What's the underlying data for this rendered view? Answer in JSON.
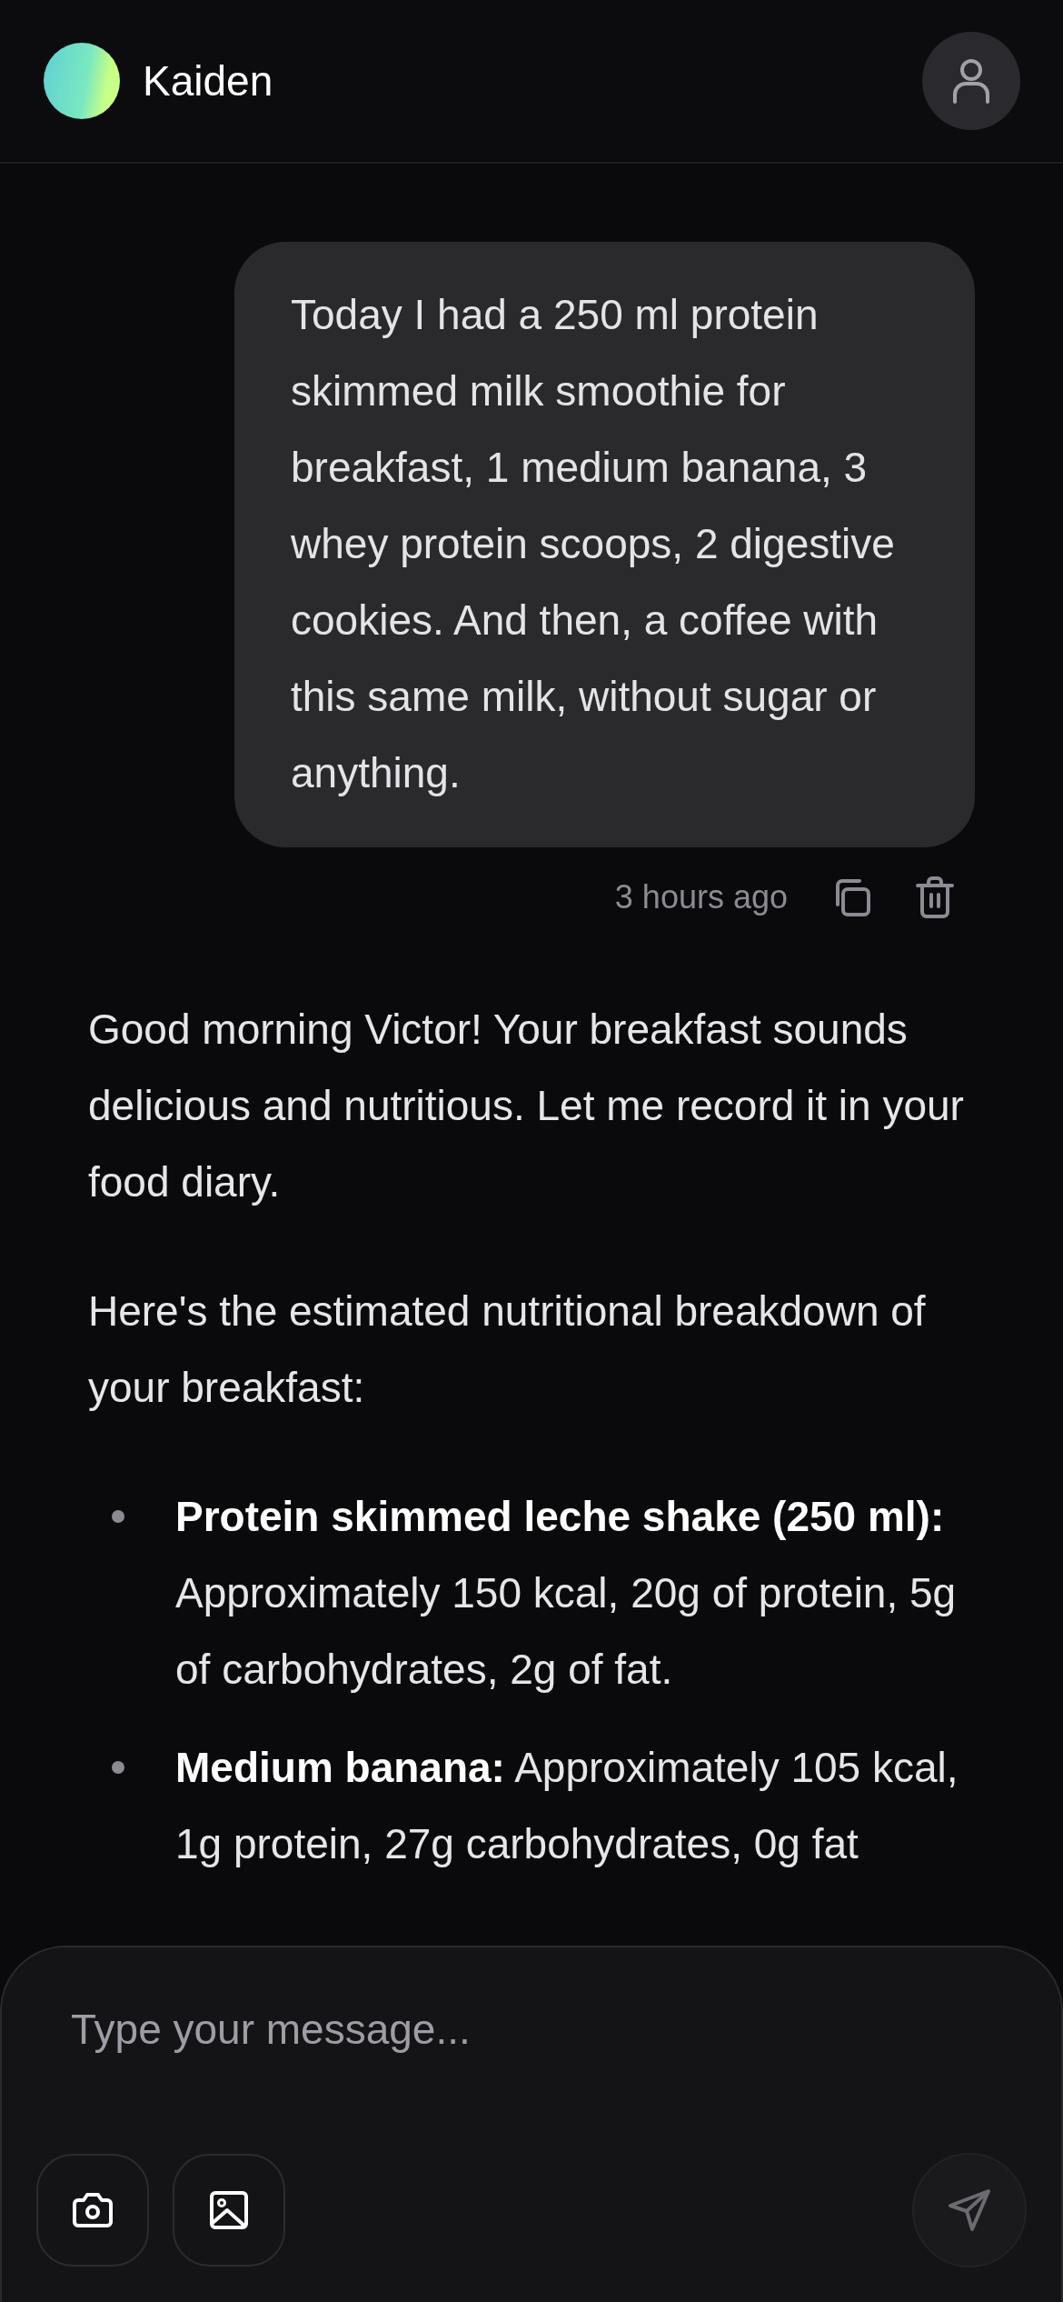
{
  "header": {
    "name": "Kaiden"
  },
  "messages": [
    {
      "kind": "user",
      "text": "Today I had a 250 ml protein skimmed milk smoothie for breakfast, 1 medium banana, 3 whey protein scoops, 2 digestive cookies. And then, a coffee with this same milk, without sugar or anything.",
      "time": "3 hours ago"
    },
    {
      "kind": "assistant",
      "paragraphs": [
        "Good morning Victor! Your breakfast sounds delicious and nutritious. Let me record it in your food diary.",
        "Here's the estimated nutritional breakdown of your breakfast:"
      ],
      "bullets": [
        "**Protein skimmed leche shake (250 ml):** Approximately 150 kcal, 20g of protein, 5g of carbohydrates, 2g of fat.",
        "**Medium banana:** Approximately 105 kcal, 1g protein, 27g carbohydrates, 0g fat"
      ]
    }
  ],
  "composer": {
    "placeholder": "Type your message..."
  }
}
